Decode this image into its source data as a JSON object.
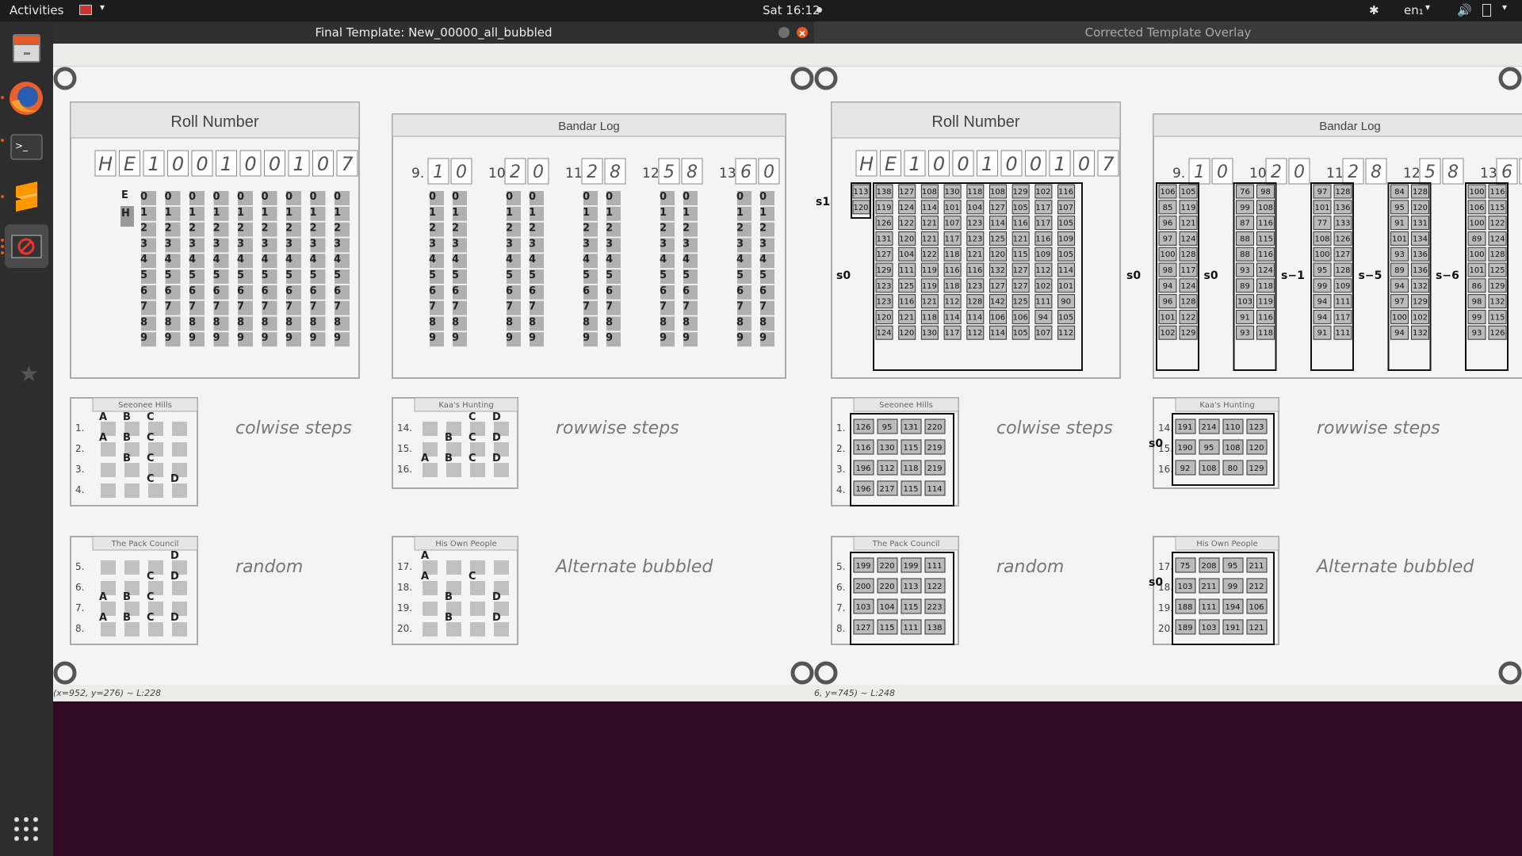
{
  "topbar": {
    "activities": "Activities",
    "clock": "Sat 16:12",
    "lang": "en₁"
  },
  "dock": {
    "apps": [
      "files-icon",
      "firefox-icon",
      "terminal-icon",
      "sublime-text-icon",
      "dont-icon",
      "extra-icon",
      "app-grid-icon"
    ]
  },
  "windows": {
    "left": {
      "title": "Final Template: New_00000_all_bubbled",
      "status": "(x=952, y=276) ~ L:228"
    },
    "right": {
      "title": "Corrected Template Overlay",
      "status": "6, y=745) ~ L:248"
    }
  },
  "sheet": {
    "roll_number_title": "Roll Number",
    "bandar_log_title": "Bandar Log",
    "roll_handwritten": [
      "H",
      "E",
      "1",
      "0",
      "0",
      "1",
      "0",
      "0",
      "1",
      "0",
      "7"
    ],
    "bandar_questions": [
      "9.",
      "10.",
      "11.",
      "12.",
      "13."
    ],
    "bandar_handwritten": [
      "1",
      "0",
      "2",
      "0",
      "2",
      "8",
      "5",
      "8",
      "6",
      "0"
    ],
    "digits": [
      "0",
      "1",
      "2",
      "3",
      "4",
      "5",
      "6",
      "7",
      "8",
      "9"
    ],
    "sections": [
      {
        "title": "Seeonee Hills",
        "questions": [
          "1.",
          "2.",
          "3.",
          "4."
        ],
        "note": "colwise steps"
      },
      {
        "title": "Kaa's Hunting",
        "questions": [
          "14.",
          "15.",
          "16."
        ],
        "note": "rowwise steps"
      },
      {
        "title": "The Pack Council",
        "questions": [
          "5.",
          "6.",
          "7.",
          "8."
        ],
        "note": "random"
      },
      {
        "title": "His Own People",
        "questions": [
          "17.",
          "18.",
          "19.",
          "20."
        ],
        "note": "Alternate bubbled"
      }
    ]
  },
  "overlay": {
    "roll_values": [
      [
        "113",
        "138",
        "127",
        "108",
        "130",
        "118",
        "108",
        "129",
        "102",
        "116"
      ],
      [
        "120",
        "119",
        "124",
        "114",
        "101",
        "104",
        "127",
        "105",
        "117",
        "107"
      ],
      [
        "",
        "126",
        "122",
        "121",
        "107",
        "123",
        "114",
        "116",
        "117",
        "105"
      ],
      [
        "",
        "131",
        "120",
        "121",
        "117",
        "123",
        "125",
        "121",
        "116",
        "109"
      ],
      [
        "",
        "127",
        "104",
        "122",
        "118",
        "121",
        "120",
        "115",
        "109",
        "105"
      ],
      [
        "",
        "129",
        "111",
        "119",
        "116",
        "116",
        "132",
        "127",
        "112",
        "114"
      ],
      [
        "",
        "123",
        "125",
        "119",
        "118",
        "123",
        "127",
        "127",
        "102",
        "101"
      ],
      [
        "",
        "123",
        "116",
        "121",
        "112",
        "128",
        "142",
        "125",
        "111",
        "90"
      ],
      [
        "",
        "120",
        "121",
        "118",
        "114",
        "114",
        "106",
        "106",
        "94",
        "105"
      ],
      [
        "",
        "124",
        "120",
        "130",
        "117",
        "112",
        "114",
        "105",
        "107",
        "112"
      ]
    ],
    "bandar_values": [
      [
        [
          "106",
          "105"
        ],
        [
          "85",
          "119"
        ],
        [
          "96",
          "121"
        ],
        [
          "97",
          "124"
        ],
        [
          "100",
          "128"
        ],
        [
          "98",
          "117"
        ],
        [
          "94",
          "124"
        ],
        [
          "96",
          "128"
        ],
        [
          "101",
          "122"
        ],
        [
          "102",
          "129"
        ]
      ],
      [
        [
          "76",
          "98"
        ],
        [
          "99",
          "108"
        ],
        [
          "87",
          "116"
        ],
        [
          "88",
          "115"
        ],
        [
          "88",
          "116"
        ],
        [
          "93",
          "124"
        ],
        [
          "89",
          "118"
        ],
        [
          "103",
          "119"
        ],
        [
          "91",
          "116"
        ],
        [
          "93",
          "118"
        ]
      ],
      [
        [
          "97",
          "128"
        ],
        [
          "101",
          "136"
        ],
        [
          "77",
          "133"
        ],
        [
          "108",
          "126"
        ],
        [
          "100",
          "127"
        ],
        [
          "95",
          "128"
        ],
        [
          "99",
          "109"
        ],
        [
          "94",
          "111"
        ],
        [
          "94",
          "117"
        ],
        [
          "91",
          "111"
        ]
      ],
      [
        [
          "84",
          "128"
        ],
        [
          "95",
          "120"
        ],
        [
          "91",
          "131"
        ],
        [
          "101",
          "134"
        ],
        [
          "93",
          "136"
        ],
        [
          "89",
          "136"
        ],
        [
          "94",
          "132"
        ],
        [
          "97",
          "129"
        ],
        [
          "100",
          "102"
        ],
        [
          "94",
          "132"
        ]
      ],
      [
        [
          "100",
          "116"
        ],
        [
          "106",
          "115"
        ],
        [
          "100",
          "122"
        ],
        [
          "89",
          "124"
        ],
        [
          "100",
          "128"
        ],
        [
          "101",
          "125"
        ],
        [
          "86",
          "129"
        ],
        [
          "98",
          "132"
        ],
        [
          "99",
          "115"
        ],
        [
          "93",
          "126"
        ]
      ]
    ],
    "bandar_shift_labels": [
      "s0",
      "s0",
      "s−1",
      "s−5",
      "s−6"
    ],
    "roll_shift_labels": [
      "s1",
      "s0"
    ],
    "section_values": [
      [
        [
          "126",
          "95",
          "131",
          "220"
        ],
        [
          "116",
          "130",
          "115",
          "219"
        ],
        [
          "196",
          "112",
          "118",
          "219"
        ],
        [
          "196",
          "217",
          "115",
          "114"
        ]
      ],
      [
        [
          "191",
          "214",
          "110",
          "123"
        ],
        [
          "190",
          "95",
          "108",
          "120"
        ],
        [
          "92",
          "108",
          "80",
          "129"
        ]
      ],
      [
        [
          "199",
          "220",
          "199",
          "111"
        ],
        [
          "200",
          "220",
          "113",
          "122"
        ],
        [
          "103",
          "104",
          "115",
          "223"
        ],
        [
          "127",
          "115",
          "111",
          "138"
        ]
      ],
      [
        [
          "75",
          "208",
          "95",
          "211"
        ],
        [
          "103",
          "211",
          "99",
          "212"
        ],
        [
          "188",
          "111",
          "194",
          "106"
        ],
        [
          "189",
          "103",
          "191",
          "121"
        ]
      ]
    ],
    "section_shift_labels": [
      "",
      "s0",
      "",
      "s0"
    ]
  },
  "left_labels": {
    "roll_letters": [
      "E",
      "H"
    ],
    "s1": [
      [
        "A",
        "B",
        "C",
        ""
      ],
      [
        "A",
        "B",
        "C",
        ""
      ],
      [
        "",
        "B",
        "C",
        ""
      ],
      [
        "",
        "",
        "C",
        "D"
      ]
    ],
    "s2": [
      [
        "",
        "",
        "C",
        "D"
      ],
      [
        "",
        "B",
        "C",
        "D"
      ],
      [
        "A",
        "B",
        "C",
        "D"
      ]
    ],
    "s3": [
      [
        "",
        "",
        "",
        "D"
      ],
      [
        "",
        "",
        "C",
        "D"
      ],
      [
        "A",
        "B",
        "C",
        ""
      ],
      [
        "A",
        "B",
        "C",
        "D"
      ]
    ],
    "s4": [
      [
        "A",
        "",
        "",
        ""
      ],
      [
        "A",
        "",
        "C",
        ""
      ],
      [
        "",
        "B",
        "",
        "D"
      ],
      [
        "",
        "B",
        "",
        "D"
      ]
    ]
  }
}
